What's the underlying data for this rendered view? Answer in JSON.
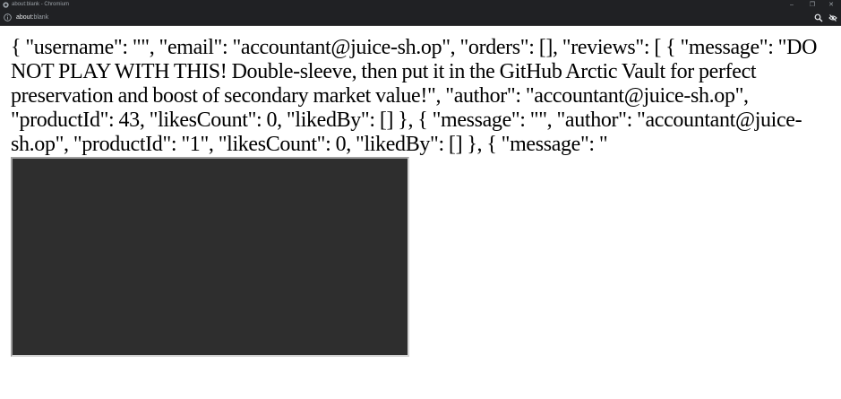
{
  "window": {
    "title": "about:blank - Chromium",
    "controls": {
      "minimize": "–",
      "maximize": "❐",
      "close": "✕"
    }
  },
  "toolbar": {
    "url_scheme": "about:",
    "url_host": "blank",
    "icons": [
      "info-icon",
      "zoom-icon",
      "eye-off-icon"
    ]
  },
  "page": {
    "json_text": "{ \"username\": \"\", \"email\": \"accountant@juice-sh.op\", \"orders\": [], \"reviews\": [ { \"message\": \"DO NOT PLAY WITH THIS! Double-sleeve, then put it in the GitHub Arctic Vault for perfect preservation and boost of secondary market value!\", \"author\": \"accountant@juice-sh.op\", \"productId\": 43, \"likesCount\": 0, \"likedBy\": [] }, { \"message\": \"\", \"author\": \"accountant@juice-sh.op\", \"productId\": \"1\", \"likesCount\": 0, \"likedBy\": [] }, { \"message\": \""
  },
  "colors": {
    "chrome_bg": "#202124",
    "page_bg": "#ffffff",
    "embedded_box": "#2e2e2e"
  }
}
